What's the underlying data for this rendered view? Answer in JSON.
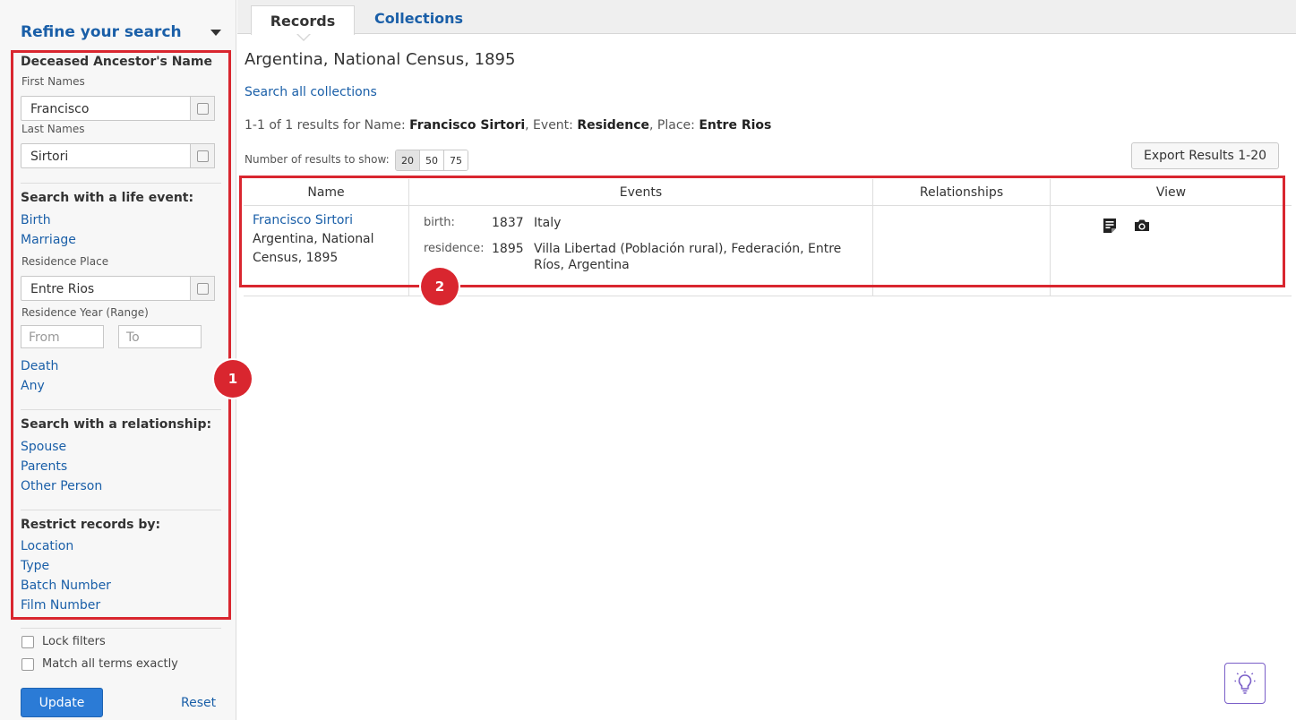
{
  "sidebar": {
    "title": "Refine your search",
    "name_section": {
      "heading": "Deceased Ancestor's Name",
      "first_names_label": "First Names",
      "first_names_value": "Francisco",
      "last_names_label": "Last Names",
      "last_names_value": "Sirtori"
    },
    "life_event": {
      "heading": "Search with a life event:",
      "birth": "Birth",
      "marriage": "Marriage",
      "residence_place_label": "Residence Place",
      "residence_place_value": "Entre Rios",
      "residence_year_label": "Residence Year (Range)",
      "from_placeholder": "From",
      "to_placeholder": "To",
      "death": "Death",
      "any": "Any"
    },
    "relationship": {
      "heading": "Search with a relationship:",
      "spouse": "Spouse",
      "parents": "Parents",
      "other_person": "Other Person"
    },
    "restrict": {
      "heading": "Restrict records by:",
      "location": "Location",
      "type": "Type",
      "batch_number": "Batch Number",
      "film_number": "Film Number"
    },
    "lock_filters": "Lock filters",
    "match_exact": "Match all terms exactly",
    "update_button": "Update",
    "reset_link": "Reset"
  },
  "tabs": {
    "records": "Records",
    "collections": "Collections"
  },
  "main": {
    "collection_title": "Argentina, National Census, 1895",
    "search_all": "Search all collections",
    "summary": {
      "prefix": "1-1 of 1 results for Name: ",
      "name": "Francisco Sirtori",
      "event_label": ", Event: ",
      "event": "Residence",
      "place_label": ", Place: ",
      "place": "Entre Rios"
    },
    "num_results_label": "Number of results to show:",
    "page_sizes": [
      "20",
      "50",
      "75"
    ],
    "export_button": "Export Results 1-20",
    "table": {
      "headers": [
        "Name",
        "Events",
        "Relationships",
        "View"
      ],
      "row": {
        "name_link": "Francisco Sirtori",
        "collection": "Argentina, National Census, 1895",
        "events": [
          {
            "label": "birth:",
            "year": "1837",
            "place": "Italy"
          },
          {
            "label": "residence:",
            "year": "1895",
            "place": "Villa Libertad (Población rural), Federación, Entre Ríos, Argentina"
          }
        ],
        "relationships": ""
      }
    }
  },
  "annotations": {
    "badge_1": "1",
    "badge_2": "2"
  },
  "icons": [
    "chevron-down-icon",
    "record-details-icon",
    "camera-icon",
    "lightbulb-icon"
  ],
  "colors": {
    "accent_link": "#1a5fa8",
    "highlight": "#d9262f",
    "primary_button": "#2b7bd6"
  }
}
